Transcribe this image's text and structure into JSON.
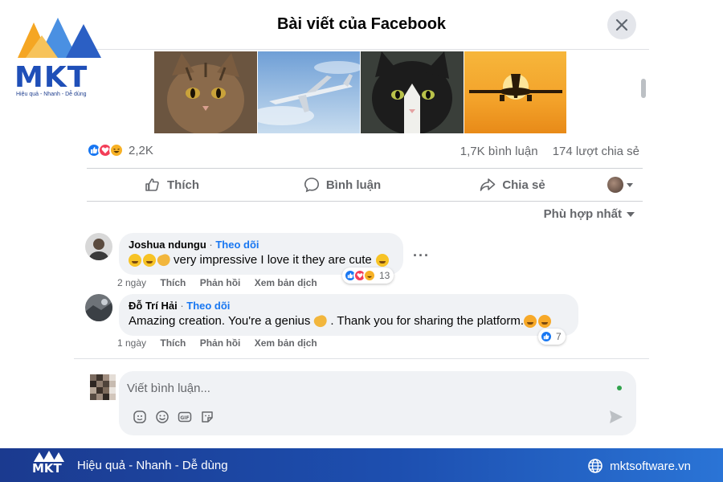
{
  "brand": {
    "logo_text": "MKT",
    "tagline": "Hiệu quả - Nhanh - Dễ dùng"
  },
  "modal": {
    "title": "Bài viết của Facebook",
    "close_icon": "close-icon"
  },
  "post": {
    "photos": [
      "cat-tabby",
      "airplane-sky",
      "cat-black-white",
      "airplane-sunset"
    ],
    "reaction_count": "2,2K",
    "comment_count": "1,7K bình luận",
    "share_count": "174 lượt chia sẻ",
    "actions": {
      "like": "Thích",
      "comment": "Bình luận",
      "share": "Chia sẻ"
    },
    "sort_label": "Phù hợp nhất"
  },
  "comments": [
    {
      "author": "Joshua ndungu",
      "follow": "Theo dõi",
      "text": "very impressive I love it they are cute",
      "time": "2 ngày",
      "like": "Thích",
      "reply": "Phản hồi",
      "translate": "Xem bản dịch",
      "reactions": "13"
    },
    {
      "author": "Đỗ Trí Hải",
      "follow": "Theo dõi",
      "text_part1": "Amazing creation. You're a genius",
      "text_part2": ". Thank you for sharing the platform.",
      "time": "1 ngày",
      "like": "Thích",
      "reply": "Phản hồi",
      "translate": "Xem bản dịch",
      "reactions": "7"
    }
  ],
  "composer": {
    "placeholder": "Viết bình luận..."
  },
  "footer": {
    "logo_text": "MKT",
    "tagline": "Hiệu quả - Nhanh - Dễ dùng",
    "website": "mktsoftware.vn"
  },
  "colors": {
    "accent": "#1877f2",
    "like": "#1877f2",
    "love": "#f33e58",
    "haha": "#f7b125",
    "footer": "#1d4fb0"
  }
}
